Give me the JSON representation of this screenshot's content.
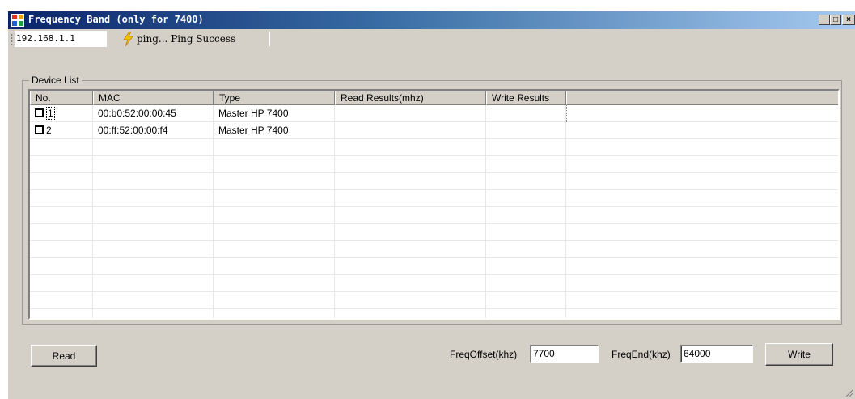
{
  "window": {
    "title": "Frequency Band (only for 7400)",
    "controls": {
      "minimize": "_",
      "maximize": "□",
      "close": "×"
    }
  },
  "toolbar": {
    "ip_address": "192.168.1.1",
    "ping_icon": "lightning-icon",
    "ping_status": "ping... Ping Success"
  },
  "device_list": {
    "legend": "Device List",
    "columns": [
      "No.",
      "MAC",
      "Type",
      "Read Results(mhz)",
      "Write Results"
    ],
    "rows": [
      {
        "no": "1",
        "mac": "00:b0:52:00:00:45",
        "type": "Master HP 7400",
        "read": "",
        "write": "",
        "checked": false
      },
      {
        "no": "2",
        "mac": "00:ff:52:00:00:f4",
        "type": "Master HP 7400",
        "read": "",
        "write": "",
        "checked": false
      }
    ]
  },
  "controls": {
    "read_button": "Read",
    "freq_offset_label": "FreqOffset(khz)",
    "freq_offset_value": "7700",
    "freq_end_label": "FreqEnd(khz)",
    "freq_end_value": "64000",
    "write_button": "Write"
  }
}
